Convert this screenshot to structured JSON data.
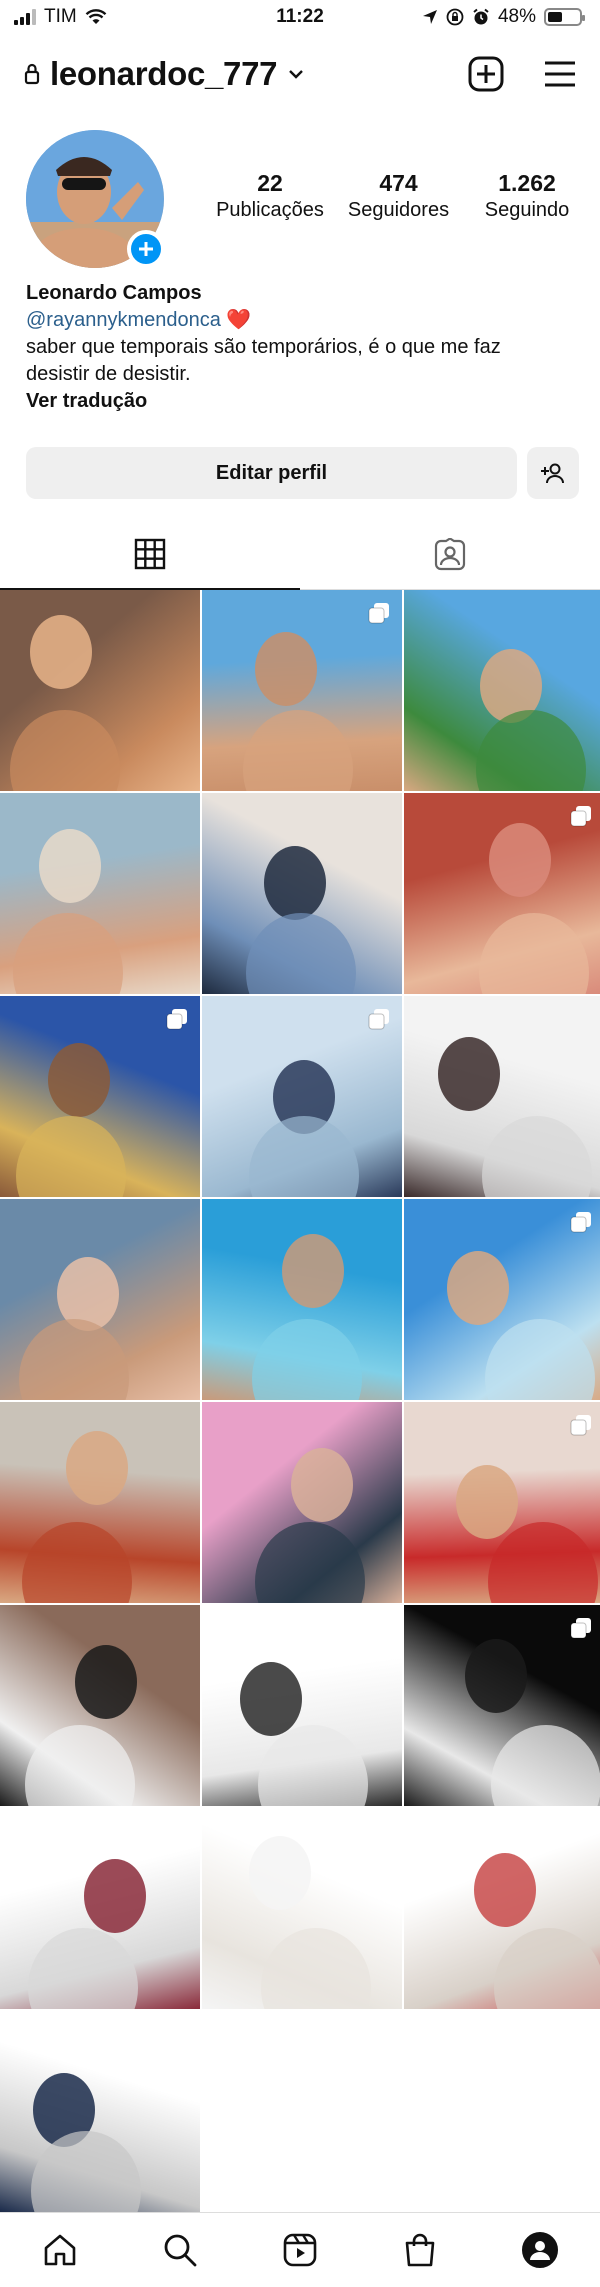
{
  "status_bar": {
    "carrier": "TIM",
    "time": "11:22",
    "battery_percent": "48%",
    "battery_level": 0.48
  },
  "header": {
    "username": "leonardoc_777",
    "icons": [
      "lock-icon",
      "chevron-down-icon",
      "create-post-icon",
      "menu-icon"
    ]
  },
  "profile": {
    "stats": [
      {
        "value": "22",
        "label": "Publicações"
      },
      {
        "value": "474",
        "label": "Seguidores"
      },
      {
        "value": "1.262",
        "label": "Seguindo"
      }
    ],
    "name": "Leonardo Campos",
    "link": "@rayannykmendonca",
    "link_emoji": "❤️",
    "bio_line1": "saber que temporais são temporários, é o que me faz",
    "bio_line2": "desistir de desistir.",
    "translate": "Ver tradução"
  },
  "actions": {
    "edit_profile": "Editar perfil"
  },
  "tabs": [
    {
      "icon": "grid-icon",
      "active": true
    },
    {
      "icon": "tagged-icon",
      "active": false
    }
  ],
  "posts": [
    {
      "multi": false,
      "colors": [
        "#7a5a48",
        "#c98a5e",
        "#e8b48a"
      ]
    },
    {
      "multi": true,
      "colors": [
        "#5fa8dc",
        "#d7a37e",
        "#c98f6a"
      ]
    },
    {
      "multi": false,
      "colors": [
        "#58a7e0",
        "#3d8a3d",
        "#d9a882"
      ]
    },
    {
      "multi": false,
      "colors": [
        "#9bb8c9",
        "#d9a07e",
        "#e8d9c9"
      ]
    },
    {
      "multi": false,
      "colors": [
        "#e8e2dc",
        "#6f8fb8",
        "#1e2a3e"
      ]
    },
    {
      "multi": true,
      "colors": [
        "#b84a3a",
        "#e8b89a",
        "#d98a7a"
      ]
    },
    {
      "multi": true,
      "colors": [
        "#2b55a8",
        "#d9b35a",
        "#8a5a3a"
      ]
    },
    {
      "multi": true,
      "colors": [
        "#cfe0ee",
        "#9ab8d0",
        "#2a3a5a"
      ]
    },
    {
      "multi": false,
      "colors": [
        "#f3f3f3",
        "#d8d8d8",
        "#3a2a2a"
      ]
    },
    {
      "multi": false,
      "colors": [
        "#6a8aa8",
        "#c99a7a",
        "#e8c0a8"
      ]
    },
    {
      "multi": false,
      "colors": [
        "#2a9ed8",
        "#7fd0e8",
        "#c99a7a"
      ]
    },
    {
      "multi": true,
      "colors": [
        "#3a8fd8",
        "#bde0f0",
        "#d9a882"
      ]
    },
    {
      "multi": false,
      "colors": [
        "#c9c2b8",
        "#b8452a",
        "#d9a882"
      ]
    },
    {
      "multi": false,
      "colors": [
        "#e8a0c8",
        "#2a3a4a",
        "#d9b09a"
      ]
    },
    {
      "multi": true,
      "colors": [
        "#e8d8d0",
        "#c82a2a",
        "#d9a882"
      ]
    },
    {
      "multi": false,
      "colors": [
        "#8a6a5a",
        "#f0f0f0",
        "#1a1a1a"
      ]
    },
    {
      "multi": false,
      "colors": [
        "#ffffff",
        "#e8e8e8",
        "#2a2a2a"
      ]
    },
    {
      "multi": true,
      "colors": [
        "#0a0a0a",
        "#e8e8e8",
        "#1a1a1a"
      ]
    },
    {
      "multi": false,
      "colors": [
        "#ffffff",
        "#d8d8d8",
        "#8a2a3a"
      ]
    },
    {
      "multi": false,
      "colors": [
        "#ffffff",
        "#e8e4de",
        "#f5f5f5"
      ]
    },
    {
      "multi": false,
      "colors": [
        "#ffffff",
        "#d8d0c8",
        "#c84a4a"
      ]
    },
    {
      "multi": false,
      "colors": [
        "#ffffff",
        "#c8c8c8",
        "#1a2a4a"
      ]
    }
  ],
  "bottom_nav": [
    {
      "icon": "home-icon"
    },
    {
      "icon": "search-icon"
    },
    {
      "icon": "reels-icon"
    },
    {
      "icon": "shop-icon"
    },
    {
      "icon": "profile-avatar-icon"
    }
  ]
}
